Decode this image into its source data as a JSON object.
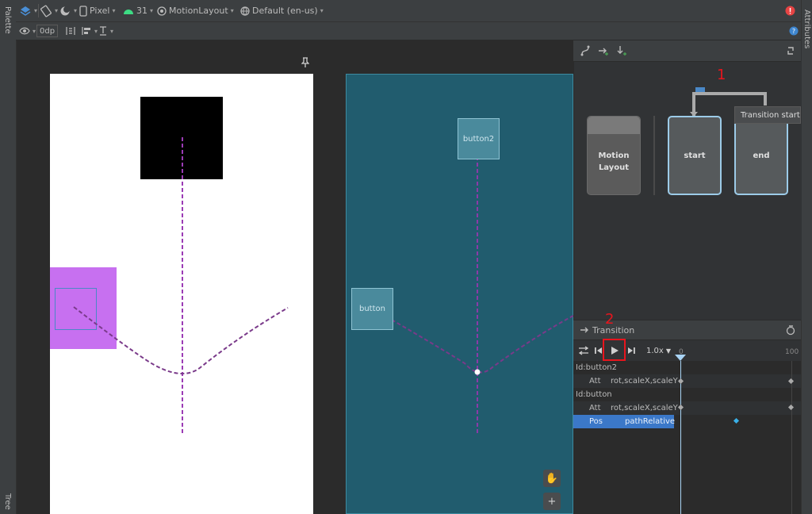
{
  "toolbar": {
    "device": "Pixel",
    "api": "31",
    "layout_type": "MotionLayout",
    "locale": "Default (en-us)",
    "margin_value": "0dp"
  },
  "side_tabs": {
    "palette": "Palette",
    "tree": "Tree",
    "attributes": "Attributes"
  },
  "blueprint": {
    "button2_label": "button2",
    "button_label": "button"
  },
  "motion_overview": {
    "cards": [
      "Motion\nLayout",
      "start",
      "end"
    ],
    "tooltip": "Transition start->end"
  },
  "transition": {
    "title": "Transition",
    "speed": "1.0x",
    "timeline_start": "0",
    "timeline_end": "100",
    "rows": [
      {
        "label": "Id:button2",
        "type": "header"
      },
      {
        "label": "Att",
        "value": "rot,scaleX,scaleY",
        "type": "attr"
      },
      {
        "label": "Id:button",
        "type": "header"
      },
      {
        "label": "Att",
        "value": "rot,scaleX,scaleY",
        "type": "attr"
      },
      {
        "label": "Pos",
        "value": "pathRelative",
        "type": "selected"
      }
    ]
  },
  "annotations": {
    "one": "1",
    "two": "2"
  },
  "colors": {
    "accent_red": "#e8151d",
    "blueprint_bg": "#215c6e",
    "path_purple": "#9b3bb5",
    "selection_blue": "#4a88c7",
    "button_purple": "#c770f0"
  },
  "icons": [
    "design-surface-icon",
    "orientation-icon",
    "night-mode-icon",
    "device-icon",
    "android-icon",
    "motionlayout-icon",
    "globe-icon",
    "error-icon",
    "help-icon",
    "eye-icon",
    "margin-icon",
    "align-icon",
    "baseline-icon",
    "pin-icon",
    "create-constraint-set-icon",
    "create-transition-icon",
    "create-onclick-icon",
    "cycle-icon",
    "swap-icon",
    "skip-back-icon",
    "play-icon",
    "skip-forward-icon",
    "pan-icon",
    "zoom-in-icon",
    "add-keyframe-icon",
    "arrow-right-icon"
  ]
}
